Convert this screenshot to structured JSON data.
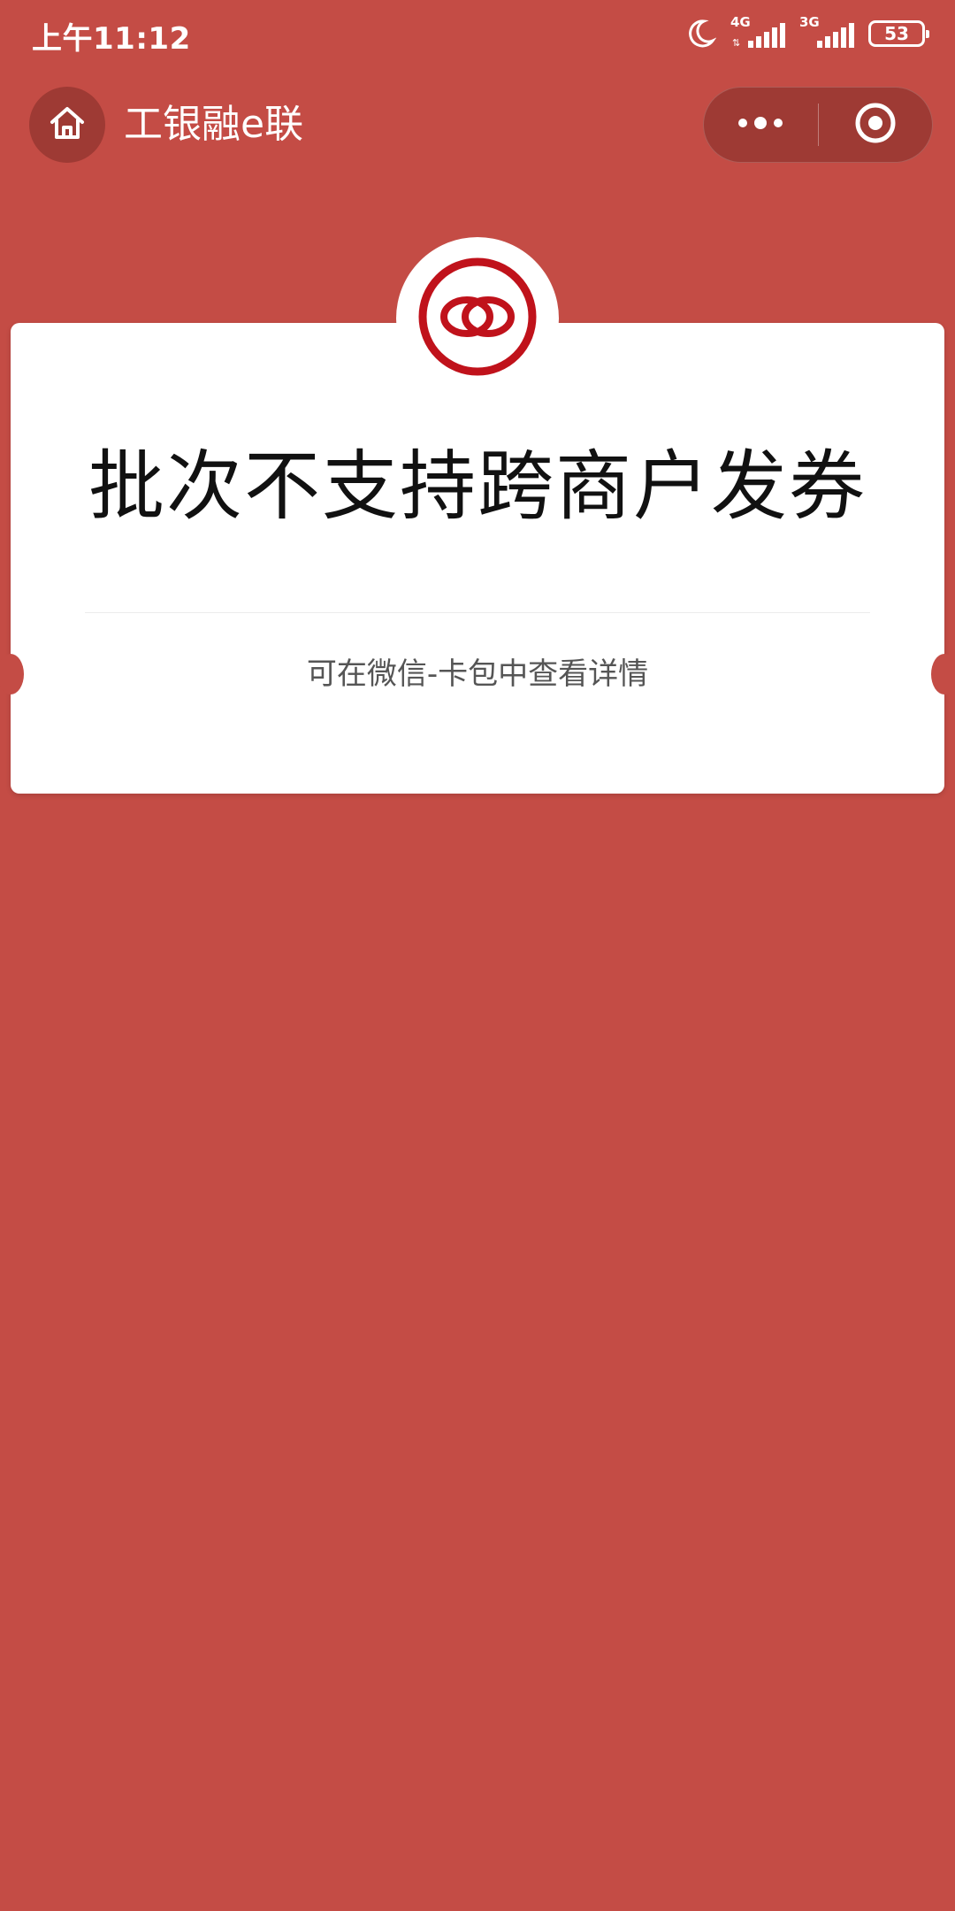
{
  "status_bar": {
    "time": "上午11:12",
    "network_1": "4G",
    "network_2": "3G",
    "battery": "53"
  },
  "title_bar": {
    "app_title": "工银融e联",
    "home_icon": "home-icon",
    "more_icon": "more-dots-icon",
    "close_icon": "target-close-icon"
  },
  "card": {
    "title": "批次不支持跨商户发券",
    "subtitle": "可在微信-卡包中查看详情",
    "logo_icon": "icbc-rings-logo"
  },
  "colors": {
    "background": "#c44c45",
    "capsule": "#9e3a34",
    "logo_red": "#c0121b"
  }
}
